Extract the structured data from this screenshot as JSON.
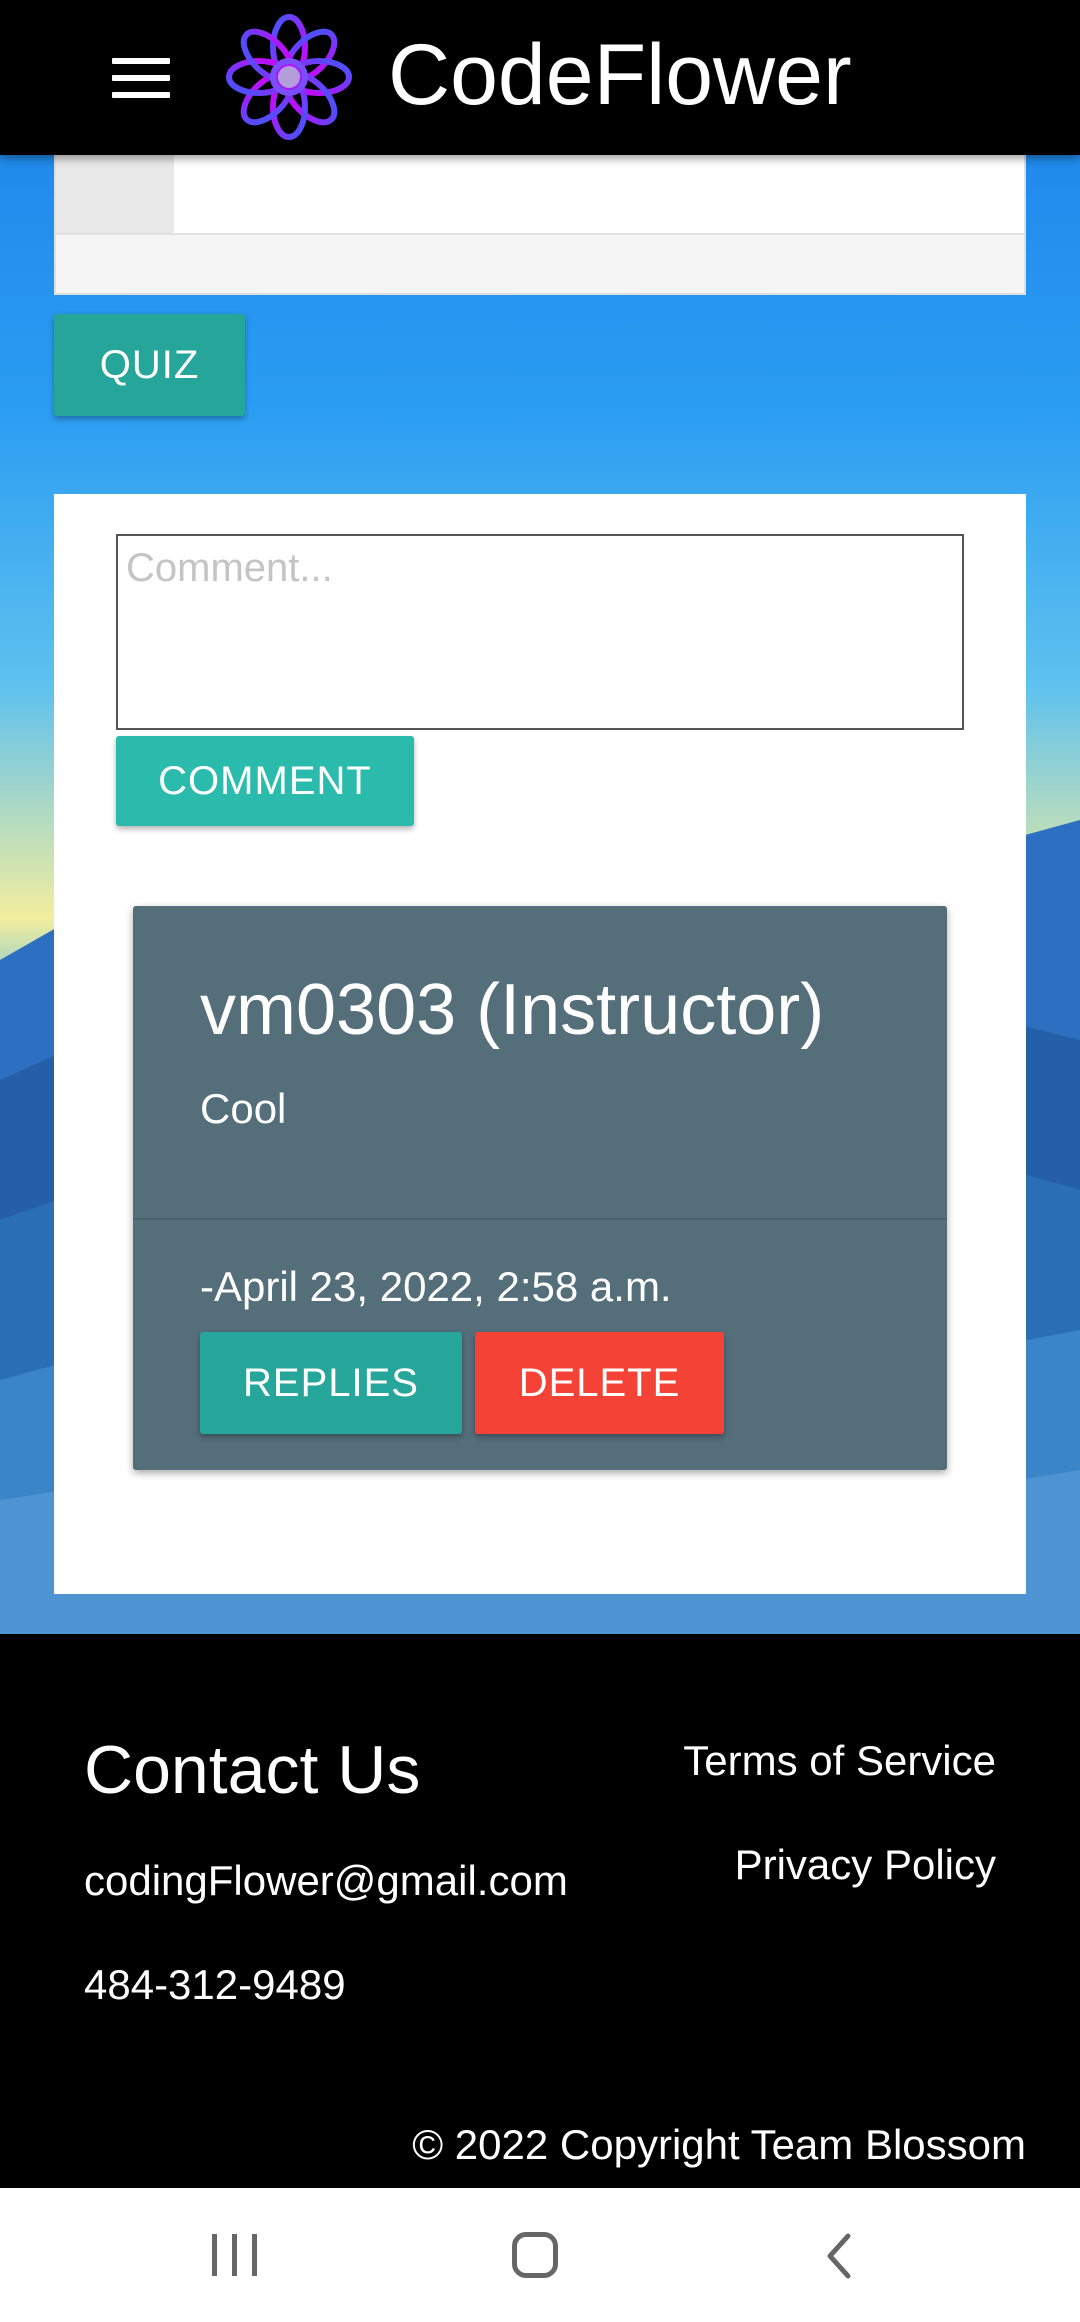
{
  "app": {
    "title": "CodeFlower"
  },
  "actions": {
    "quiz_label": "QUIZ"
  },
  "comment_form": {
    "placeholder": "Comment...",
    "value": "",
    "submit_label": "COMMENT"
  },
  "comments": [
    {
      "author": "vm0303 (Instructor)",
      "text": "Cool",
      "date": "-April 23, 2022, 2:58 a.m.",
      "replies_label": "REPLIES",
      "delete_label": "DELETE"
    }
  ],
  "footer": {
    "contact_title": "Contact Us",
    "email": "codingFlower@gmail.com",
    "phone": "484-312-9489",
    "links": [
      "Terms of Service",
      "Privacy Policy"
    ],
    "copyright": "© 2022 Copyright Team Blossom"
  },
  "colors": {
    "teal": "#26a69a",
    "teal_light": "#2bbbad",
    "red": "#f44336",
    "card_slate": "#546e7a",
    "header": "#000000"
  },
  "icons": {
    "menu": "hamburger-menu-icon",
    "logo": "flower-logo-icon",
    "nav_recent": "recent-apps-icon",
    "nav_home": "home-icon",
    "nav_back": "back-icon"
  }
}
